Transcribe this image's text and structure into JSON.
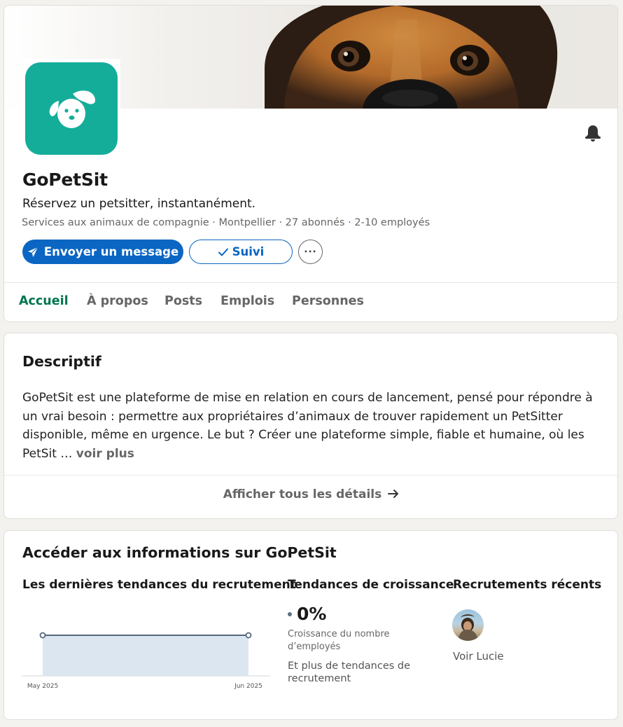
{
  "company": {
    "name": "GoPetSit",
    "tagline": "Réservez un petsitter, instantanément.",
    "industry": "Services aux animaux de compagnie",
    "location": "Montpellier",
    "followers": "27 abonnés",
    "employees": "2-10 employés",
    "separator": " · "
  },
  "actions": {
    "message_label": "Envoyer un message",
    "follow_label": "Suivi",
    "more_label": "•••"
  },
  "tabs": [
    {
      "label": "Accueil",
      "active": true
    },
    {
      "label": "À propos",
      "active": false
    },
    {
      "label": "Posts",
      "active": false
    },
    {
      "label": "Emplois",
      "active": false
    },
    {
      "label": "Personnes",
      "active": false
    }
  ],
  "description": {
    "title": "Descriptif",
    "text": "GoPetSit est une plateforme de mise en relation en cours de lancement, pensé pour répondre à un vrai besoin : permettre aux propriétaires d’animaux de trouver rapidement un PetSitter disponible, même en urgence. Le but ? Créer une plateforme simple, fiable et humaine, où les PetSit …",
    "see_more": "voir plus",
    "show_all": "Afficher tous les détails"
  },
  "insights": {
    "title": "Accéder aux informations sur GoPetSit",
    "hiring_trends_title": "Les dernières tendances du recrutement",
    "growth_title": "Tendances de croissance",
    "growth_value": "0%",
    "growth_caption": "Croissance du nombre d’employés",
    "more_trends": "Et plus de tendances de recrutement",
    "recent_hires_title": "Recrutements récents",
    "recent_hire_label": "Voir Lucie"
  },
  "chart_data": {
    "type": "area",
    "x": [
      "May 2025",
      "Jun 2025"
    ],
    "series": [
      {
        "values": [
          1,
          1
        ]
      }
    ],
    "fill_color": "#dce6f1",
    "line_color": "#56687a"
  },
  "colors": {
    "brand_blue": "#0a66c2",
    "active_tab": "#01754f",
    "logo_bg": "#14ad9a"
  }
}
